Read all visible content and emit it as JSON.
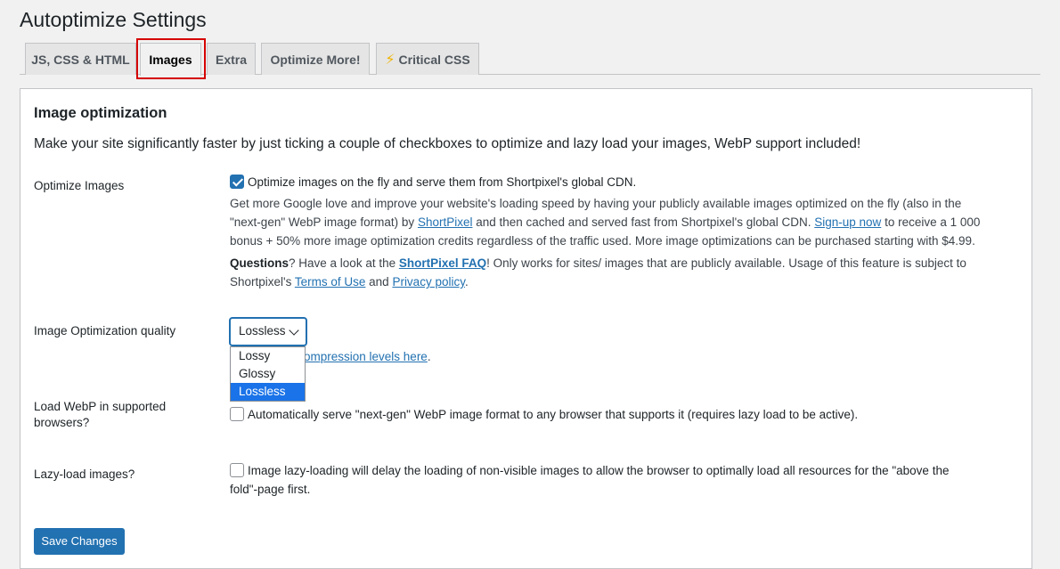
{
  "page": {
    "title": "Autoptimize Settings"
  },
  "tabs": [
    {
      "label": "JS, CSS & HTML"
    },
    {
      "label": "Images"
    },
    {
      "label": "Extra"
    },
    {
      "label": "Optimize More!"
    },
    {
      "label": "Critical CSS",
      "icon": "lightning-icon"
    }
  ],
  "active_tab": "Images",
  "section": {
    "title": "Image optimization",
    "description": "Make your site significantly faster by just ticking a couple of checkboxes to optimize and lazy load your images, WebP support included!"
  },
  "optimize_images": {
    "label": "Optimize Images",
    "checked": true,
    "checkbox_text": "Optimize images on the fly and serve them from Shortpixel's global CDN.",
    "desc_1": "Get more Google love and improve your website's loading speed by having your publicly available images optimized on the fly (also in the",
    "desc_2a": "\"next-gen\" WebP image format) by ",
    "link_shortpixel": "ShortPixel",
    "desc_2b": " and then cached and served fast from Shortpixel's global CDN. ",
    "link_signup": "Sign-up now",
    "desc_2c": " to receive a 1 000",
    "desc_3": "bonus + 50% more image optimization credits regardless of the traffic used. More image optimizations can be purchased starting with $4.99.",
    "questions_bold": "Questions",
    "q_text_a": "? Have a look at the ",
    "link_faq": "ShortPixel FAQ",
    "q_text_b": "! Only works for sites/ images that are publicly available. Usage of this feature is subject to",
    "q_text_c": "Shortpixel's ",
    "link_terms": "Terms of Use",
    "q_and": " and ",
    "link_privacy": "Privacy policy",
    "q_end": "."
  },
  "quality": {
    "label": "Image Optimization quality",
    "selected": "Lossless",
    "options": [
      "Lossy",
      "Glossy",
      "Lossless"
    ],
    "link_partial": "ompression levels here",
    "link_suffix": "."
  },
  "webp": {
    "label_line1": "Load WebP in supported",
    "label_line2": "browsers?",
    "checked": false,
    "text": "Automatically serve \"next-gen\" WebP image format to any browser that supports it (requires lazy load to be active)."
  },
  "lazy": {
    "label": "Lazy-load images?",
    "checked": false,
    "text_1": "Image lazy-loading will delay the loading of non-visible images to allow the browser to optimally load all resources for the \"above the",
    "text_2": "fold\"-page first."
  },
  "save_button": "Save Changes",
  "colors": {
    "primary": "#2271b1",
    "highlight": "#d50000",
    "selected_option": "#1a73e8"
  }
}
